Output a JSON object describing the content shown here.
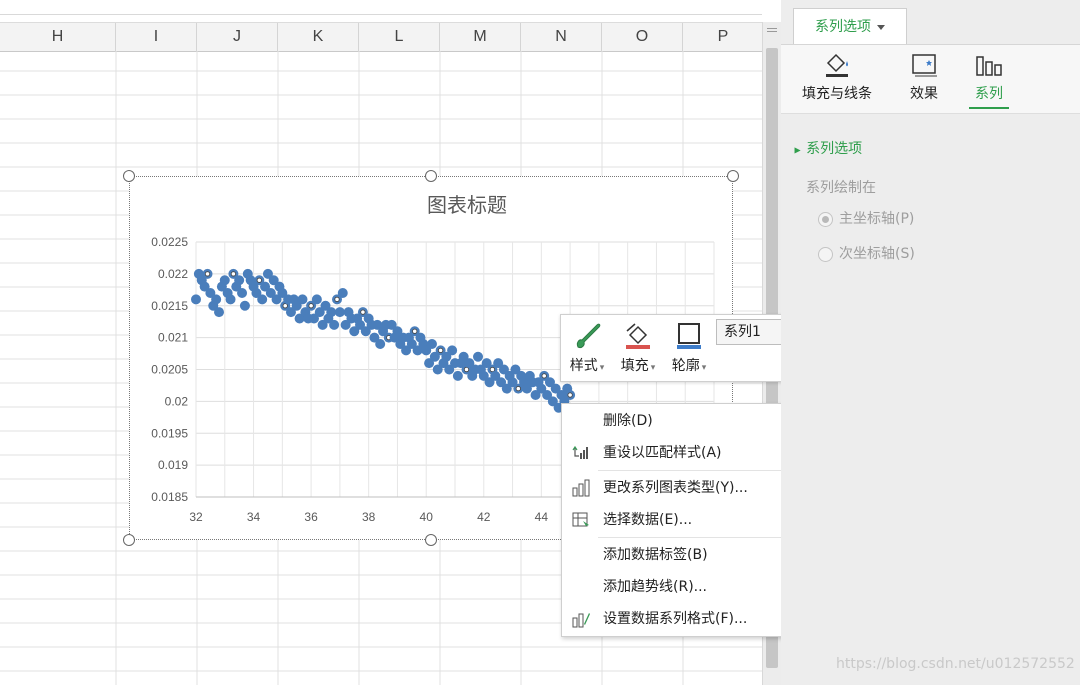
{
  "sheet": {
    "columns": [
      "H",
      "I",
      "J",
      "K",
      "L",
      "M",
      "N",
      "O",
      "P"
    ]
  },
  "chart": {
    "title": "图表标题"
  },
  "chart_data": {
    "type": "scatter",
    "title": "图表标题",
    "xlabel": "",
    "ylabel": "",
    "xlim": [
      32,
      50
    ],
    "ylim": [
      0.0185,
      0.0225
    ],
    "x_ticks": [
      "32",
      "34",
      "36",
      "38",
      "40",
      "42",
      "44"
    ],
    "y_ticks": [
      "0.0225",
      "0.022",
      "0.0215",
      "0.021",
      "0.0205",
      "0.02",
      "0.0195",
      "0.019",
      "0.0185"
    ],
    "grid": true,
    "series": [
      {
        "name": "系列1",
        "color": "#4a7ebb",
        "points": [
          [
            32.0,
            0.0216
          ],
          [
            32.1,
            0.022
          ],
          [
            32.2,
            0.0219
          ],
          [
            32.3,
            0.0218
          ],
          [
            32.4,
            0.022
          ],
          [
            32.5,
            0.0217
          ],
          [
            32.6,
            0.0215
          ],
          [
            32.7,
            0.0216
          ],
          [
            32.8,
            0.0214
          ],
          [
            32.9,
            0.0218
          ],
          [
            33.0,
            0.0219
          ],
          [
            33.1,
            0.0217
          ],
          [
            33.2,
            0.0216
          ],
          [
            33.3,
            0.022
          ],
          [
            33.4,
            0.0218
          ],
          [
            33.5,
            0.0219
          ],
          [
            33.6,
            0.0217
          ],
          [
            33.7,
            0.0215
          ],
          [
            33.8,
            0.022
          ],
          [
            33.9,
            0.0219
          ],
          [
            34.0,
            0.0218
          ],
          [
            34.1,
            0.0217
          ],
          [
            34.2,
            0.0219
          ],
          [
            34.3,
            0.0216
          ],
          [
            34.4,
            0.0218
          ],
          [
            34.5,
            0.022
          ],
          [
            34.6,
            0.0217
          ],
          [
            34.7,
            0.0219
          ],
          [
            34.8,
            0.0216
          ],
          [
            34.9,
            0.0218
          ],
          [
            35.0,
            0.0217
          ],
          [
            35.1,
            0.0215
          ],
          [
            35.2,
            0.0216
          ],
          [
            35.3,
            0.0214
          ],
          [
            35.4,
            0.0216
          ],
          [
            35.5,
            0.0215
          ],
          [
            35.6,
            0.0213
          ],
          [
            35.7,
            0.0216
          ],
          [
            35.8,
            0.0214
          ],
          [
            35.9,
            0.0213
          ],
          [
            36.0,
            0.0215
          ],
          [
            36.1,
            0.0213
          ],
          [
            36.2,
            0.0216
          ],
          [
            36.3,
            0.0214
          ],
          [
            36.4,
            0.0212
          ],
          [
            36.5,
            0.0215
          ],
          [
            36.6,
            0.0213
          ],
          [
            36.7,
            0.0214
          ],
          [
            36.8,
            0.0212
          ],
          [
            36.9,
            0.0216
          ],
          [
            37.0,
            0.0214
          ],
          [
            37.1,
            0.0217
          ],
          [
            37.2,
            0.0212
          ],
          [
            37.3,
            0.0214
          ],
          [
            37.4,
            0.0213
          ],
          [
            37.5,
            0.0211
          ],
          [
            37.6,
            0.0213
          ],
          [
            37.7,
            0.0212
          ],
          [
            37.8,
            0.0214
          ],
          [
            37.9,
            0.0211
          ],
          [
            38.0,
            0.0213
          ],
          [
            38.1,
            0.0212
          ],
          [
            38.2,
            0.021
          ],
          [
            38.3,
            0.0212
          ],
          [
            38.4,
            0.0209
          ],
          [
            38.5,
            0.0211
          ],
          [
            38.6,
            0.0212
          ],
          [
            38.7,
            0.021
          ],
          [
            38.8,
            0.0212
          ],
          [
            38.9,
            0.021
          ],
          [
            39.0,
            0.0211
          ],
          [
            39.1,
            0.0209
          ],
          [
            39.2,
            0.021
          ],
          [
            39.3,
            0.0208
          ],
          [
            39.4,
            0.021
          ],
          [
            39.5,
            0.0209
          ],
          [
            39.6,
            0.0211
          ],
          [
            39.7,
            0.0208
          ],
          [
            39.8,
            0.021
          ],
          [
            39.9,
            0.0209
          ],
          [
            40.0,
            0.0208
          ],
          [
            40.1,
            0.0206
          ],
          [
            40.2,
            0.0209
          ],
          [
            40.3,
            0.0207
          ],
          [
            40.4,
            0.0205
          ],
          [
            40.5,
            0.0208
          ],
          [
            40.6,
            0.0206
          ],
          [
            40.7,
            0.0207
          ],
          [
            40.8,
            0.0205
          ],
          [
            40.9,
            0.0208
          ],
          [
            41.0,
            0.0206
          ],
          [
            41.1,
            0.0204
          ],
          [
            41.2,
            0.0206
          ],
          [
            41.3,
            0.0207
          ],
          [
            41.4,
            0.0205
          ],
          [
            41.5,
            0.0206
          ],
          [
            41.6,
            0.0204
          ],
          [
            41.7,
            0.0205
          ],
          [
            41.8,
            0.0207
          ],
          [
            41.9,
            0.0205
          ],
          [
            42.0,
            0.0204
          ],
          [
            42.1,
            0.0206
          ],
          [
            42.2,
            0.0203
          ],
          [
            42.3,
            0.0205
          ],
          [
            42.4,
            0.0204
          ],
          [
            42.5,
            0.0206
          ],
          [
            42.6,
            0.0203
          ],
          [
            42.7,
            0.0205
          ],
          [
            42.8,
            0.0202
          ],
          [
            42.9,
            0.0204
          ],
          [
            43.0,
            0.0203
          ],
          [
            43.1,
            0.0205
          ],
          [
            43.2,
            0.0202
          ],
          [
            43.3,
            0.0204
          ],
          [
            43.4,
            0.0203
          ],
          [
            43.5,
            0.0202
          ],
          [
            43.6,
            0.0204
          ],
          [
            43.7,
            0.0203
          ],
          [
            43.8,
            0.0201
          ],
          [
            43.9,
            0.0203
          ],
          [
            44.0,
            0.0202
          ],
          [
            44.1,
            0.0204
          ],
          [
            44.2,
            0.0201
          ],
          [
            44.3,
            0.0203
          ],
          [
            44.4,
            0.02
          ],
          [
            44.5,
            0.0202
          ],
          [
            44.6,
            0.0199
          ],
          [
            44.7,
            0.0201
          ],
          [
            44.8,
            0.02
          ],
          [
            44.9,
            0.0202
          ],
          [
            45.0,
            0.0201
          ]
        ]
      }
    ]
  },
  "mini_toolbar": {
    "style_label": "样式",
    "fill_label": "填充",
    "outline_label": "轮廓",
    "series_value": "系列1"
  },
  "context_menu": {
    "items": [
      {
        "label": "删除(D)"
      },
      {
        "label": "重设以匹配样式(A)"
      },
      {
        "label": "更改系列图表类型(Y)..."
      },
      {
        "label": "选择数据(E)..."
      },
      {
        "label": "添加数据标签(B)"
      },
      {
        "label": "添加趋势线(R)..."
      },
      {
        "label": "设置数据系列格式(F)..."
      }
    ]
  },
  "panel": {
    "tab_label": "系列选项",
    "subtabs": [
      "填充与线条",
      "效果",
      "系列"
    ],
    "section_title": "系列选项",
    "plot_on_label": "系列绘制在",
    "primary_axis": "主坐标轴(P)",
    "secondary_axis": "次坐标轴(S)",
    "accent_color": "#2f9e4c"
  },
  "watermark": "https://blog.csdn.net/u012572552"
}
